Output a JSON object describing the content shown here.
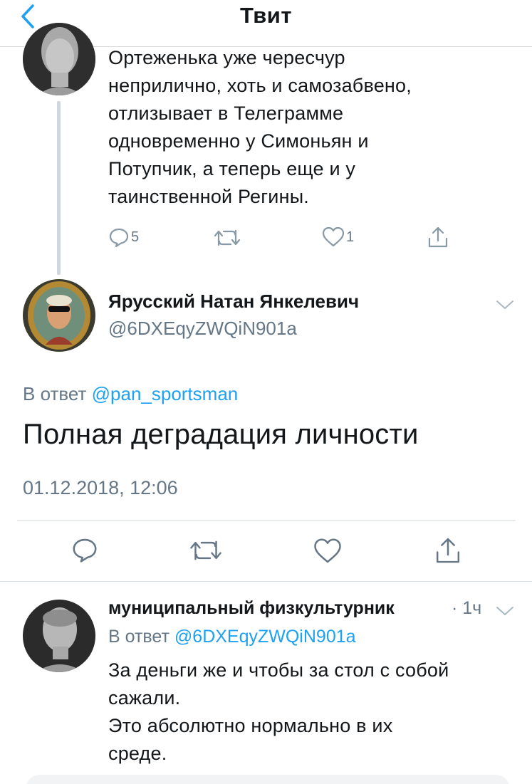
{
  "header": {
    "title": "Твит",
    "back_icon": "chevron-left-icon",
    "accent": "#1da1f2"
  },
  "parent_tweet": {
    "text_lines": [
      "Ортеженька уже чересчур",
      "неприлично, хоть и самозабвено,",
      "отлизывает в Телеграмме",
      "одновременно у Симоньян и",
      "Потупчик, а теперь еще и у",
      "таинственной Регины."
    ],
    "replies": "5",
    "likes": "1"
  },
  "main_tweet": {
    "name": "Ярусский Натан Янкелевич",
    "handle": "@6DXEqyZWQiN901a",
    "replying_prefix": "В ответ",
    "replying_to": "@pan_sportsman",
    "text": "Полная деградация личности",
    "timestamp": "01.12.2018, 12:06"
  },
  "reply_tweet": {
    "name": "муниципальный физкультурник",
    "time": "· 1ч",
    "replying_prefix": "В ответ",
    "replying_to": "@6DXEqyZWQiN901a",
    "text_lines": [
      "За деньги же и чтобы за стол с собой",
      "сажали.",
      "Это абсолютно нормально в их",
      "среде."
    ]
  }
}
